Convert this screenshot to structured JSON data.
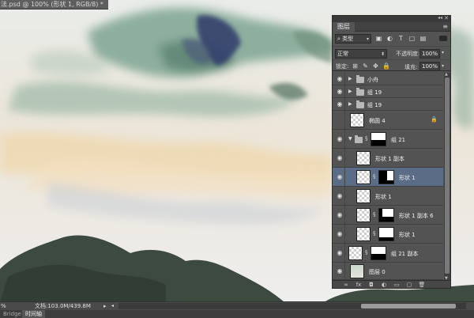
{
  "document_tab": {
    "title": "法.psd @ 100% (形状 1, RGB/8) *"
  },
  "layers_panel": {
    "tab_label": "图层",
    "filter": {
      "label": "类型"
    },
    "filter_icons": [
      "image-filter-icon",
      "adjustment-filter-icon",
      "type-filter-icon",
      "shape-filter-icon",
      "smart-object-filter-icon"
    ],
    "blend_mode": "正常",
    "opacity_label": "不透明度:",
    "opacity_value": "100%",
    "lock_label": "锁定:",
    "fill_label": "填充:",
    "fill_value": "100%",
    "layers": [
      {
        "name": "小舟",
        "type": "group",
        "visible": true
      },
      {
        "name": "组 19",
        "type": "group",
        "visible": true
      },
      {
        "name": "组 19",
        "type": "group",
        "visible": true
      },
      {
        "name": "椭圆 4",
        "type": "shape",
        "visible": false,
        "locked": true
      },
      {
        "name": "组 21",
        "type": "group-open",
        "visible": true,
        "has_mask": true
      },
      {
        "name": "形状 1 副本",
        "type": "layer",
        "visible": true,
        "indent": true
      },
      {
        "name": "形状 1",
        "type": "layer-mask",
        "visible": true,
        "indent": true,
        "selected": true
      },
      {
        "name": "形状 1",
        "type": "layer",
        "visible": true,
        "indent": true
      },
      {
        "name": "形状 1 副本 6",
        "type": "layer-mask",
        "visible": true,
        "indent": true
      },
      {
        "name": "形状 1",
        "type": "layer-mask",
        "visible": true,
        "indent": true
      },
      {
        "name": "组 21 副本",
        "type": "group-mask",
        "visible": true
      },
      {
        "name": "图层 0",
        "type": "background",
        "visible": true
      }
    ]
  },
  "status_bar": {
    "zoom": "%",
    "doc_info": "文档:103.0M/439.8M"
  },
  "bottom_tabs": [
    "Bridge",
    "时间轴"
  ],
  "colors": {
    "panel_bg": "#535353",
    "selected_row": "#5a6c86",
    "canvas_sky": "#ece8e2",
    "mountain_dark": "#3d4a40"
  }
}
